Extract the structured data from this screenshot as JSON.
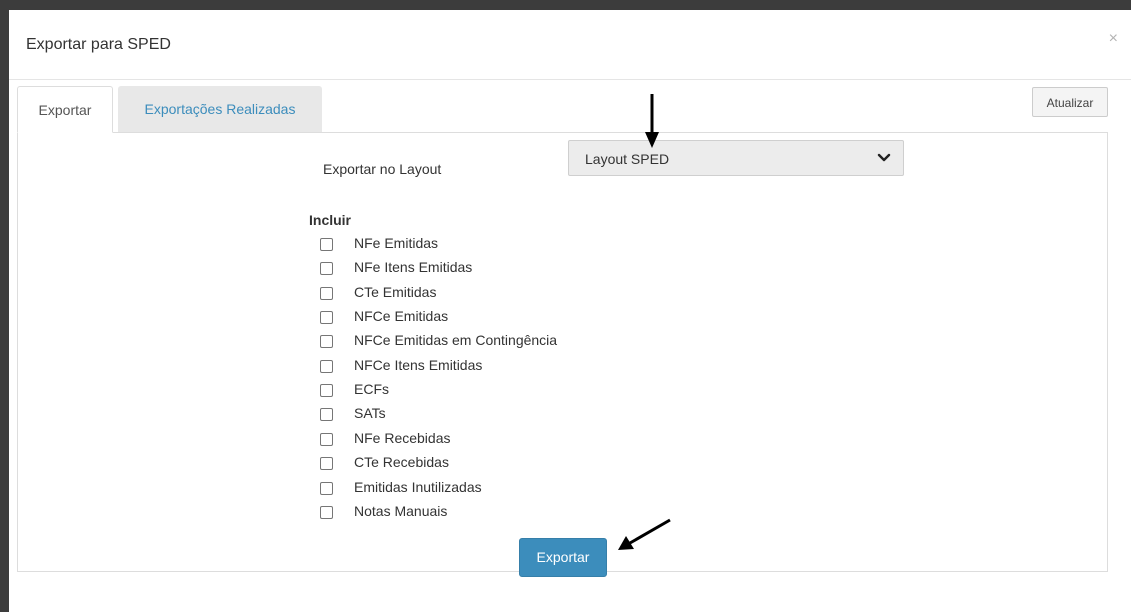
{
  "dialog": {
    "title": "Exportar para SPED",
    "close_glyph": "×"
  },
  "tabs": [
    {
      "label": "Exportar",
      "active": true
    },
    {
      "label": "Exportações Realizadas",
      "active": false
    }
  ],
  "toolbar": {
    "refresh_label": "Atualizar"
  },
  "layout_field": {
    "label": "Exportar no Layout",
    "selected": "Layout SPED"
  },
  "include": {
    "title": "Incluir",
    "options": [
      {
        "label": "NFe Emitidas",
        "checked": false
      },
      {
        "label": "NFe Itens Emitidas",
        "checked": false
      },
      {
        "label": "CTe Emitidas",
        "checked": false
      },
      {
        "label": "NFCe Emitidas",
        "checked": false
      },
      {
        "label": "NFCe Emitidas em Contingência",
        "checked": false
      },
      {
        "label": "NFCe Itens Emitidas",
        "checked": false
      },
      {
        "label": "ECFs",
        "checked": false
      },
      {
        "label": "SATs",
        "checked": false
      },
      {
        "label": "NFe Recebidas",
        "checked": false
      },
      {
        "label": "CTe Recebidas",
        "checked": false
      },
      {
        "label": "Emitidas Inutilizadas",
        "checked": false
      },
      {
        "label": "Notas Manuais",
        "checked": false
      }
    ]
  },
  "actions": {
    "export_label": "Exportar"
  },
  "colors": {
    "primary": "#3c8dbc",
    "tab_inactive_bg": "#e8e8e8",
    "select_bg": "#ececec",
    "frame": "#3c3c3c"
  }
}
